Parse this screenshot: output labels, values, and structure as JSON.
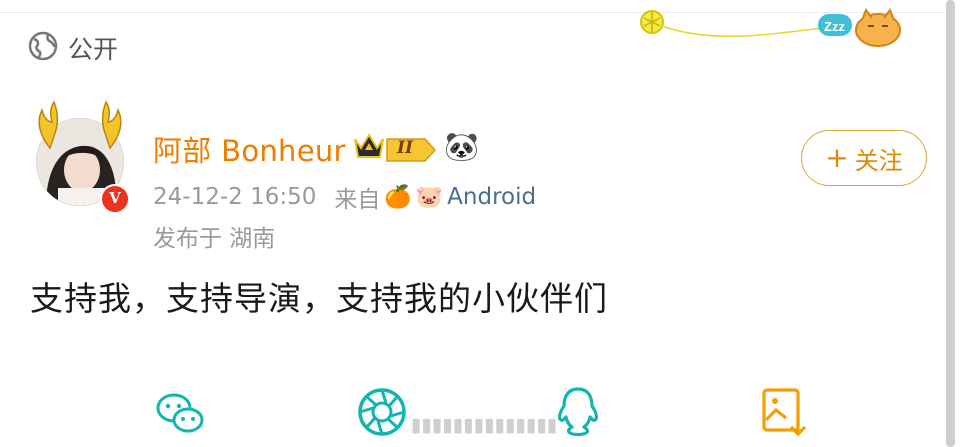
{
  "visibility": {
    "label": "公开",
    "icon": "globe-icon"
  },
  "user": {
    "name": "阿部 Bonheur",
    "level": "II",
    "emoji": "🐼",
    "verified_badge": "V"
  },
  "meta": {
    "time": "24-12-2 16:50",
    "from_label": "来自",
    "source_emojis": [
      "🍊",
      "🐷"
    ],
    "device": "Android",
    "location": "发布于 湖南"
  },
  "follow_button": {
    "label": "关注",
    "plus": "+"
  },
  "post": {
    "text": "支持我，支持导演，支持我的小伙伴们"
  },
  "share_icons": [
    "wechat-icon",
    "moments-icon",
    "qq-icon",
    "save-image-icon"
  ],
  "colors": {
    "username": "#f07c00",
    "follow": "#e08a00",
    "share": "#13b5b0",
    "save": "#f0a000",
    "device": "#4a6d90"
  }
}
